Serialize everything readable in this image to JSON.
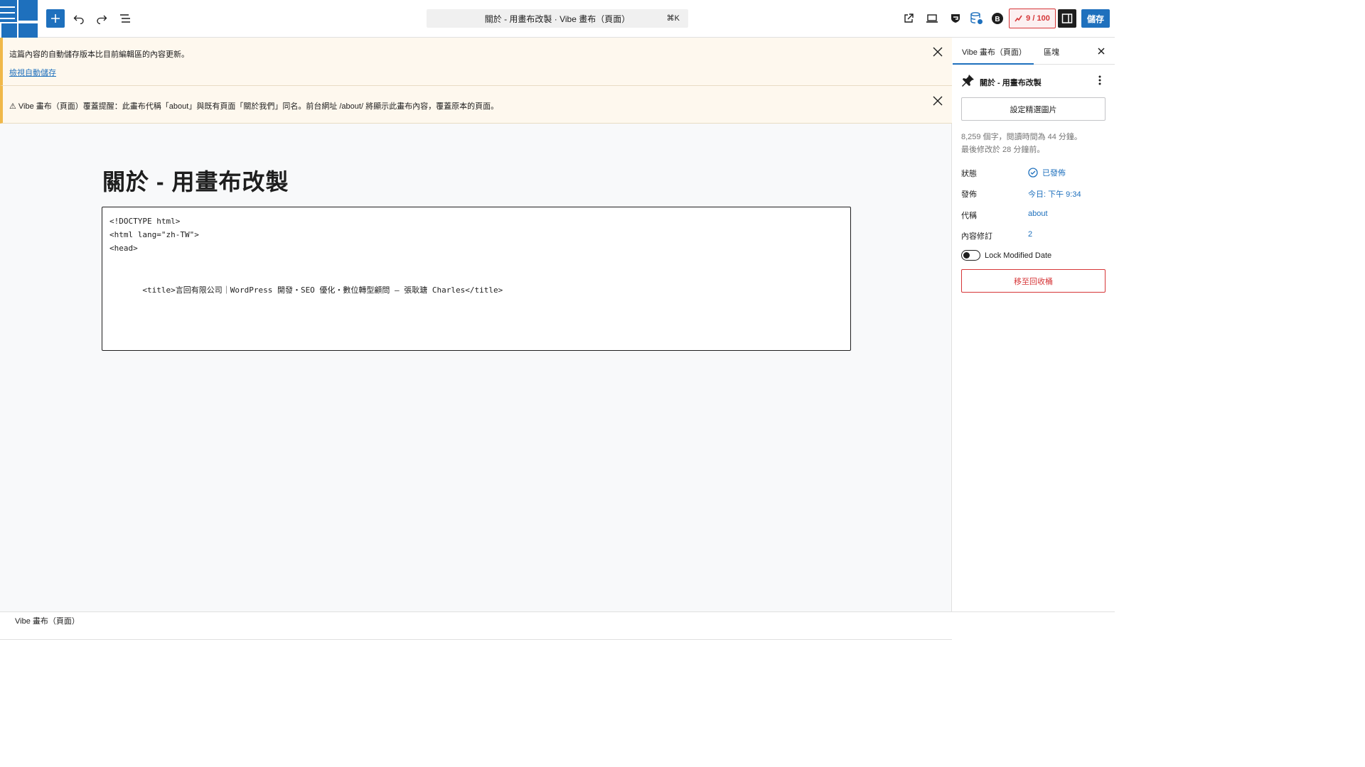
{
  "toolbar": {
    "command_bar_text": "關於 - 用畫布改製 · Vibe 畫布（頁面）",
    "command_shortcut": "⌘K",
    "seo_score": "9 / 100",
    "save_label": "儲存"
  },
  "notices": [
    {
      "text": "這篇內容的自動儲存版本比目前編輯區的內容更新。",
      "link": "檢視自動儲存"
    },
    {
      "text": "⚠ Vibe 畫布（頁面）覆蓋提醒：此畫布代稱「about」與既有頁面「關於我們」同名。前台網址 /about/ 將顯示此畫布內容，覆蓋原本的頁面。"
    }
  ],
  "editor": {
    "page_title": "關於 - 用畫布改製",
    "code_lines": [
      "<!DOCTYPE html>",
      "<html lang=\"zh-TW\">",
      "<head>",
      "",
      "",
      "       <title>言回有限公司｜WordPress 開發・SEO 優化・數位轉型顧問 – 張耿瑭 Charles</title>"
    ]
  },
  "statusbar": {
    "breadcrumb": "Vibe 畫布（頁面）"
  },
  "sidebar": {
    "tabs": [
      {
        "label": "Vibe 畫布（頁面）"
      },
      {
        "label": "區塊"
      }
    ],
    "doc_title": "關於 - 用畫布改製",
    "featured_image_label": "設定精選圖片",
    "meta_line1": "8,259 個字，閱讀時間為 44 分鐘。",
    "meta_line2": "最後修改於 28 分鐘前。",
    "rows": [
      {
        "label": "狀態",
        "value": "已發佈"
      },
      {
        "label": "發佈",
        "value": "今日: 下午 9:34"
      },
      {
        "label": "代稱",
        "value": "about"
      },
      {
        "label": "內容修訂",
        "value": "2"
      }
    ],
    "lock_label": "Lock Modified Date",
    "trash_label": "移至回收桶"
  },
  "colors": {
    "accent": "#1e70bd",
    "danger": "#d63638",
    "notice_bg": "#fef8ee",
    "notice_border": "#f0b849"
  }
}
